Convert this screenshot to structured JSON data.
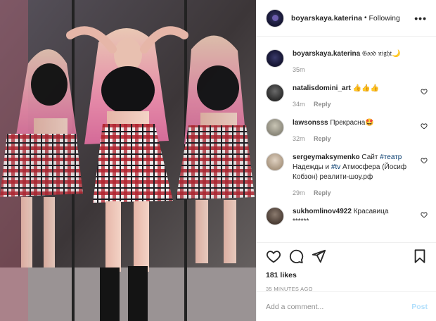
{
  "post": {
    "username": "boyarskaya.katerina",
    "follow_status": "Following",
    "more_label": "•••"
  },
  "caption": {
    "username": "boyarskaya.katerina",
    "text": "𝔊𝔬𝔬𝔡 𝔫𝔦𝔤𝔥𝔱🌙",
    "time": "35m"
  },
  "comments": [
    {
      "username": "natalisdomini_art",
      "text": "👍👍👍",
      "time": "34m",
      "reply": "Reply",
      "avatar_color": "#3b3b3b"
    },
    {
      "username": "lawsonsss",
      "text": "Прекрасна🤩",
      "time": "32m",
      "reply": "Reply",
      "avatar_color": "#9a9a8a"
    },
    {
      "username": "sergeymaksymenko",
      "text_pre": "Сайт ",
      "tag1": "#театр",
      "text_mid": " Надежды и ",
      "tag2": "#tv",
      "text_post": " Атмосфера (Йосиф Кобзон) реалити-шоу.рф",
      "time": "29m",
      "reply": "Reply",
      "avatar_color": "#c9b7a4"
    },
    {
      "username": "sukhomlinov4922",
      "text": "Красавица",
      "text2": "******",
      "avatar_color": "#6a5a50"
    }
  ],
  "actions": {
    "likes": "181 likes",
    "time_ago": "35 MINUTES AGO"
  },
  "add_comment": {
    "placeholder": "Add a comment...",
    "post_label": "Post"
  },
  "colors": {
    "accent_link": "#00376b",
    "post_button_disabled": "#b2dffc",
    "muted": "#8e8e8e"
  }
}
